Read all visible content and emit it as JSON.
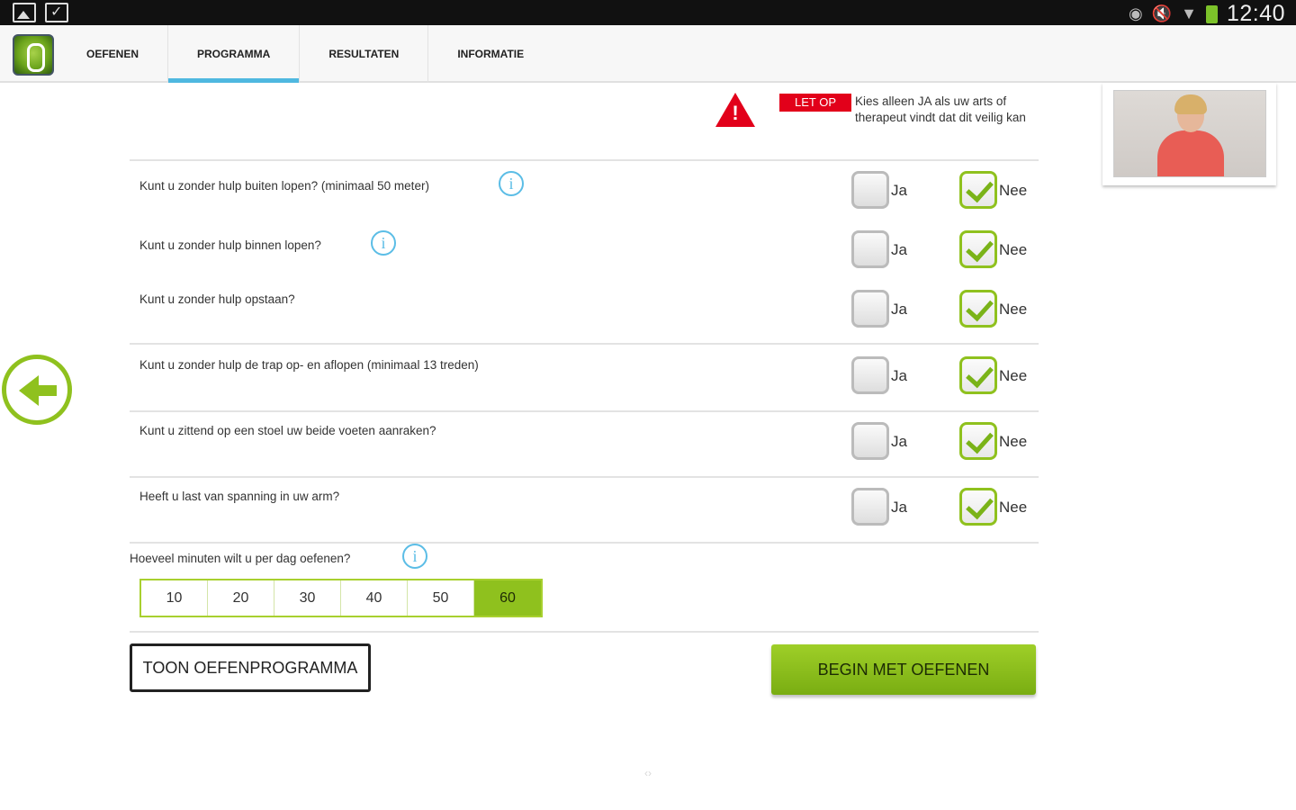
{
  "status_bar": {
    "time": "12:40",
    "icons": [
      "gallery-icon",
      "shopping-bag-icon",
      "alarm-icon",
      "mute-icon",
      "wifi-icon",
      "battery-icon"
    ]
  },
  "tabs": [
    {
      "label": "OEFENEN",
      "active": false
    },
    {
      "label": "PROGRAMMA",
      "active": true
    },
    {
      "label": "RESULTATEN",
      "active": false
    },
    {
      "label": "INFORMATIE",
      "active": false
    }
  ],
  "warning": {
    "badge": "LET OP",
    "text": "Kies alleen JA als uw arts of therapeut vindt dat dit veilig kan"
  },
  "questions": [
    {
      "text": "Kunt u zonder hulp buiten lopen? (minimaal 50 meter)",
      "has_info": true,
      "yes_label": "Ja",
      "no_label": "Nee",
      "answer": "Nee"
    },
    {
      "text": "Kunt u zonder hulp binnen lopen?",
      "has_info": true,
      "yes_label": "Ja",
      "no_label": "Nee",
      "answer": "Nee"
    },
    {
      "text": "Kunt u zonder hulp opstaan?",
      "has_info": false,
      "yes_label": "Ja",
      "no_label": "Nee",
      "answer": "Nee"
    },
    {
      "text": "Kunt u zonder hulp de trap op- en aflopen (minimaal 13 treden)",
      "has_info": false,
      "yes_label": "Ja",
      "no_label": "Nee",
      "answer": "Nee"
    },
    {
      "text": "Kunt u zittend op een stoel uw beide voeten aanraken?",
      "has_info": false,
      "yes_label": "Ja",
      "no_label": "Nee",
      "answer": "Nee"
    },
    {
      "text": "Heeft u last van spanning in uw arm?",
      "has_info": false,
      "yes_label": "Ja",
      "no_label": "Nee",
      "answer": "Nee"
    }
  ],
  "minutes": {
    "label": "Hoeveel minuten wilt u per dag oefenen?",
    "options": [
      "10",
      "20",
      "30",
      "40",
      "50",
      "60"
    ],
    "selected": "60"
  },
  "buttons": {
    "show_program": "TOON OEFENPROGRAMMA",
    "start": "BEGIN MET OEFENEN"
  },
  "info_glyph": "i",
  "warning_glyph": "!",
  "colors": {
    "accent_green": "#8fc11e",
    "tab_indicator": "#4fb8e0",
    "warning_red": "#e2001a",
    "info_blue": "#5bbde6"
  }
}
